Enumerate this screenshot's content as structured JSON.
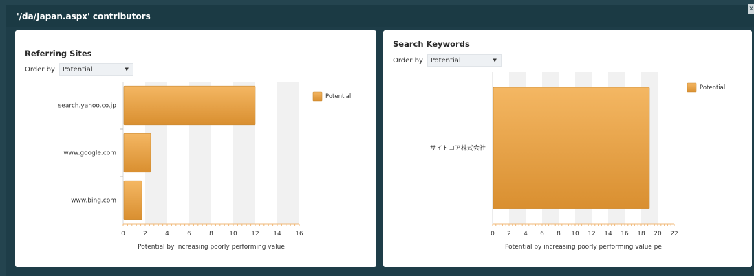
{
  "window": {
    "title": "'/da/Japan.aspx' contributors",
    "close_label": "x"
  },
  "panels": [
    {
      "title": "Referring Sites",
      "order_by_label": "Order by",
      "order_by_value": "Potential",
      "legend": "Potential",
      "xlabel": "Potential by increasing poorly performing value",
      "chart_data": {
        "type": "bar",
        "orientation": "horizontal",
        "categories": [
          "search.yahoo.co.jp",
          "www.google.com",
          "www.bing.com"
        ],
        "series": [
          {
            "name": "Potential",
            "values": [
              12,
              2.5,
              1.7
            ]
          }
        ],
        "xlim": [
          0,
          16
        ],
        "xticks": [
          "0",
          "2",
          "4",
          "6",
          "8",
          "10",
          "12",
          "14",
          "16"
        ],
        "bar_color": "#e8a24a"
      }
    },
    {
      "title": "Search Keywords",
      "order_by_label": "Order by",
      "order_by_value": "Potential",
      "legend": "Potential",
      "xlabel": "Potential by increasing poorly performing value pe",
      "chart_data": {
        "type": "bar",
        "orientation": "horizontal",
        "categories": [
          "サイトコア株式会社"
        ],
        "series": [
          {
            "name": "Potential",
            "values": [
              19
            ]
          }
        ],
        "xlim": [
          0,
          22
        ],
        "xticks": [
          "0",
          "2",
          "4",
          "6",
          "8",
          "10",
          "12",
          "14",
          "16",
          "18",
          "20",
          "22"
        ],
        "bar_color": "#e8a24a"
      }
    }
  ]
}
